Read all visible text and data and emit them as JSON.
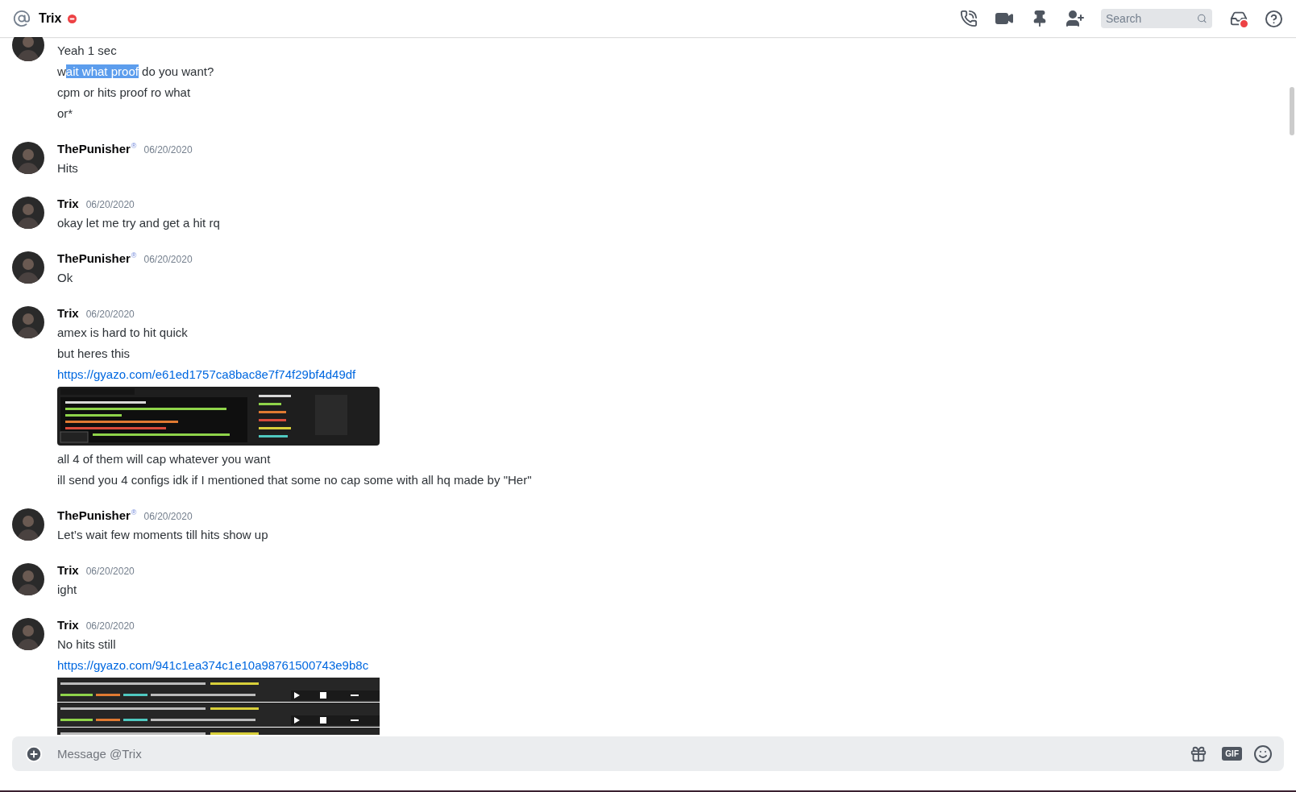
{
  "header": {
    "title": "Trix",
    "search": {
      "placeholder": "Search"
    }
  },
  "messages": [
    {
      "cut": true,
      "items": [
        {
          "kind": "text",
          "segments": [
            {
              "text": "Yeah 1 sec",
              "selected": false
            }
          ]
        },
        {
          "kind": "text",
          "segments": [
            {
              "text": "w",
              "selected": false
            },
            {
              "text": "ait what proof",
              "selected": true
            },
            {
              "text": " do you want?",
              "selected": false
            }
          ]
        },
        {
          "kind": "text",
          "segments": [
            {
              "text": "cpm or hits proof ro what",
              "selected": false
            }
          ]
        },
        {
          "kind": "text",
          "segments": [
            {
              "text": "or*",
              "selected": false
            }
          ]
        }
      ]
    },
    {
      "author": "ThePunisher",
      "badge": "®",
      "date": "06/20/2020",
      "items": [
        {
          "kind": "text",
          "segments": [
            {
              "text": "Hits",
              "selected": false
            }
          ]
        }
      ]
    },
    {
      "author": "Trix",
      "date": "06/20/2020",
      "items": [
        {
          "kind": "text",
          "segments": [
            {
              "text": "okay let me try and get a hit rq",
              "selected": false
            }
          ]
        }
      ]
    },
    {
      "author": "ThePunisher",
      "badge": "®",
      "date": "06/20/2020",
      "items": [
        {
          "kind": "text",
          "segments": [
            {
              "text": "Ok",
              "selected": false
            }
          ]
        }
      ]
    },
    {
      "author": "Trix",
      "date": "06/20/2020",
      "items": [
        {
          "kind": "text",
          "segments": [
            {
              "text": "amex is hard to hit quick",
              "selected": false
            }
          ]
        },
        {
          "kind": "text",
          "segments": [
            {
              "text": "but heres this",
              "selected": false
            }
          ]
        },
        {
          "kind": "link",
          "text": "https://gyazo.com/e61ed1757ca8bac8e7f74f29bf4d49df"
        },
        {
          "kind": "picture"
        },
        {
          "kind": "text",
          "segments": [
            {
              "text": "all 4 of them will cap whatever you want",
              "selected": false
            }
          ]
        },
        {
          "kind": "text",
          "segments": [
            {
              "text": "ill send you 4 configs idk if I mentioned that some no cap some with all hq made by \"Her\"",
              "selected": false
            }
          ]
        }
      ]
    },
    {
      "author": "ThePunisher",
      "badge": "®",
      "date": "06/20/2020",
      "items": [
        {
          "kind": "text",
          "segments": [
            {
              "text": "Let’s wait few moments till hits show up",
              "selected": false
            }
          ]
        }
      ]
    },
    {
      "author": "Trix",
      "date": "06/20/2020",
      "items": [
        {
          "kind": "text",
          "segments": [
            {
              "text": "ight",
              "selected": false
            }
          ]
        }
      ]
    },
    {
      "author": "Trix",
      "date": "06/20/2020",
      "items": [
        {
          "kind": "text",
          "segments": [
            {
              "text": "No hits still",
              "selected": false
            }
          ]
        },
        {
          "kind": "link",
          "text": "https://gyazo.com/941c1ea374c1e10a98761500743e9b8c"
        },
        {
          "kind": "picture"
        }
      ]
    }
  ],
  "composer": {
    "placeholder": "Message @Trix",
    "gif": "GIF"
  }
}
